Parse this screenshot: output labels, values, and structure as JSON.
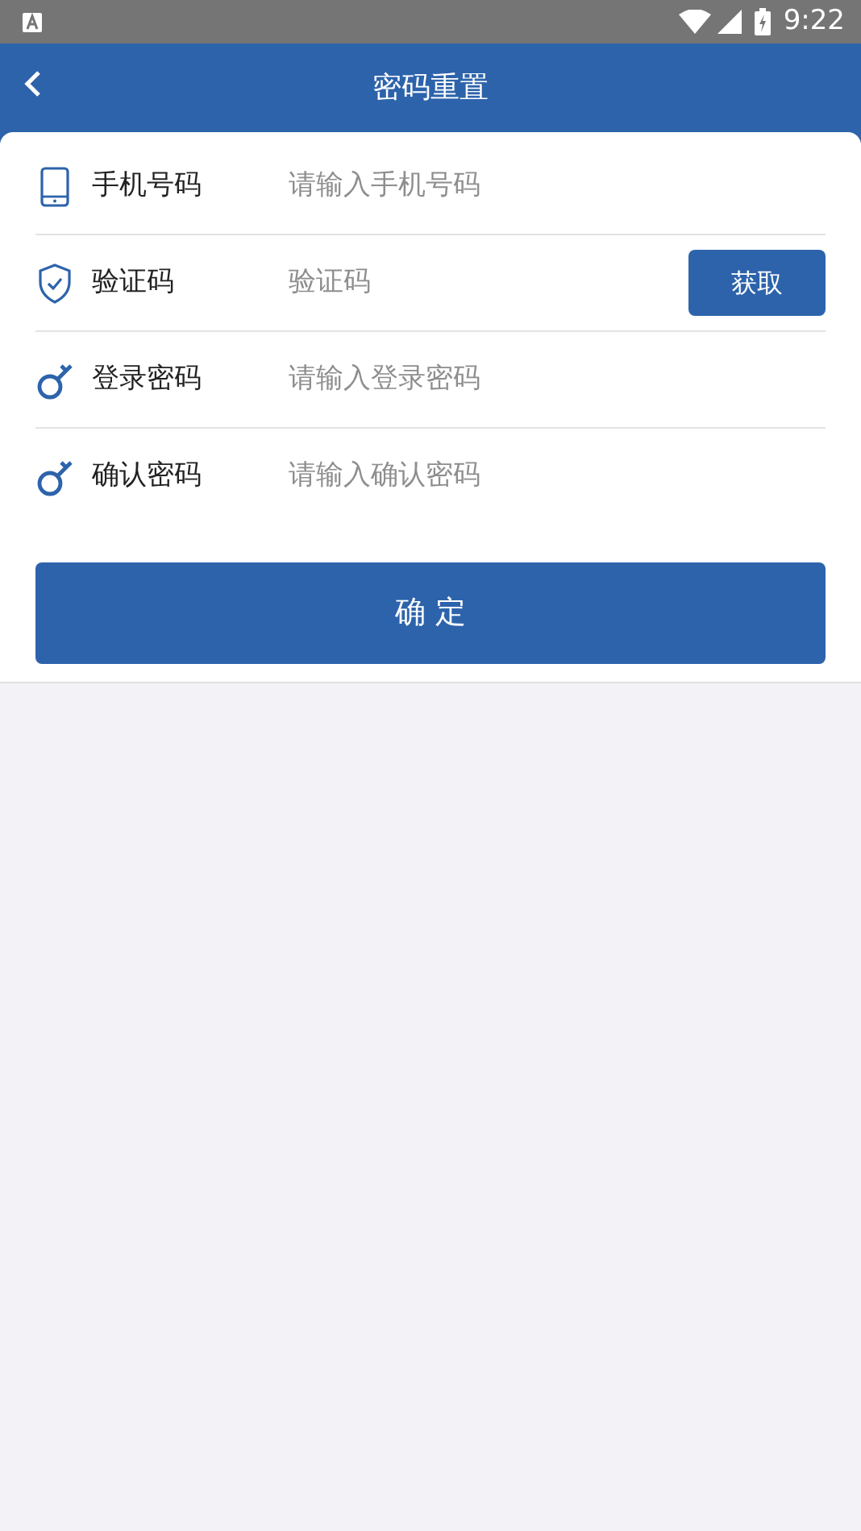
{
  "status_bar": {
    "time": "9:22"
  },
  "header": {
    "title": "密码重置"
  },
  "fields": [
    {
      "kind": "phone",
      "label": "手机号码",
      "placeholder": "请输入手机号码"
    },
    {
      "kind": "code",
      "label": "验证码",
      "placeholder": "验证码",
      "button": "获取"
    },
    {
      "kind": "password",
      "label": "登录密码",
      "placeholder": "请输入登录密码"
    },
    {
      "kind": "password",
      "label": "确认密码",
      "placeholder": "请输入确认密码"
    }
  ],
  "submit_button": "确 定"
}
